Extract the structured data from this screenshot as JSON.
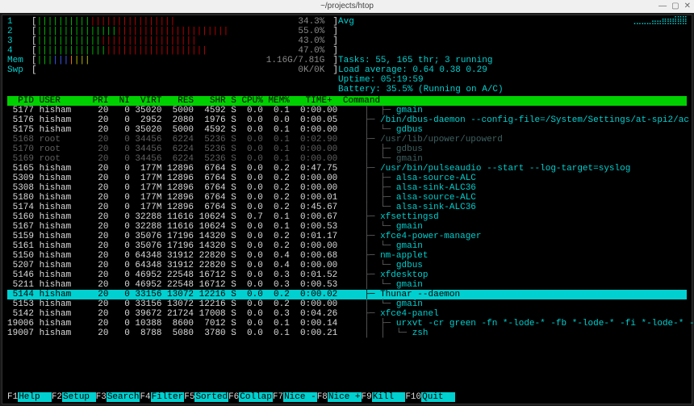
{
  "window": {
    "title": "~/projects/htop"
  },
  "meters": {
    "cpu": [
      {
        "label": "1",
        "pct": "34.3%"
      },
      {
        "label": "2",
        "pct": "55.0%"
      },
      {
        "label": "3",
        "pct": "43.0%"
      },
      {
        "label": "4",
        "pct": "47.0%"
      }
    ],
    "mem": {
      "label": "Mem",
      "value": "1.16G/7.81G"
    },
    "swp": {
      "label": "Swp",
      "value": "0K/0K"
    }
  },
  "info": {
    "avg_label": "Avg",
    "tasks": "Tasks: 55, 165 thr; 3 running",
    "loadavg": "Load average: 0.64 0.38 0.29",
    "uptime": "Uptime: 05:19:59",
    "battery": "Battery: 35.5% (Running on A/C)"
  },
  "headers": "  PID USER      PRI  NI  VIRT   RES   SHR S CPU% MEM%   TIME+  Command",
  "processes": [
    {
      "cols": " 5177 hisham     20   0 35020  5000  4592 S  0.0  0.1  0:00.00",
      "tree": "   │  ├─ ",
      "cmd": "gmain"
    },
    {
      "cols": " 5176 hisham     20   0  2952  2080  1976 S  0.0  0.0  0:00.05",
      "tree": "   ├─ ",
      "cmd": "/bin/dbus-daemon --config-file=/System/Settings/at-spi2/ac"
    },
    {
      "cols": " 5175 hisham     20   0 35020  5000  4592 S  0.0  0.1  0:00.00",
      "tree": "   │  └─ ",
      "cmd": "gdbus"
    },
    {
      "cols": " 5168 root       20   0 34456  6224  5236 S  0.0  0.1  0:02.90",
      "tree": "   ├─ ",
      "cmd": "/usr/lib/upower/upowerd",
      "dim": true
    },
    {
      "cols": " 5170 root       20   0 34456  6224  5236 S  0.0  0.1  0:00.00",
      "tree": "   │  ├─ ",
      "cmd": "gdbus",
      "dim": true
    },
    {
      "cols": " 5169 root       20   0 34456  6224  5236 S  0.0  0.1  0:00.00",
      "tree": "   │  └─ ",
      "cmd": "gmain",
      "dim": true
    },
    {
      "cols": " 5165 hisham     20   0  177M 12896  6764 S  0.0  0.2  0:47.75",
      "tree": "   ├─ ",
      "cmd": "/usr/bin/pulseaudio --start --log-target=syslog"
    },
    {
      "cols": " 5309 hisham     20   0  177M 12896  6764 S  0.0  0.2  0:00.00",
      "tree": "   │  ├─ ",
      "cmd": "alsa-source-ALC"
    },
    {
      "cols": " 5308 hisham     20   0  177M 12896  6764 S  0.0  0.2  0:00.00",
      "tree": "   │  ├─ ",
      "cmd": "alsa-sink-ALC36"
    },
    {
      "cols": " 5180 hisham     20   0  177M 12896  6764 S  0.0  0.2  0:00.01",
      "tree": "   │  ├─ ",
      "cmd": "alsa-source-ALC"
    },
    {
      "cols": " 5174 hisham     20   0  177M 12896  6764 S  0.0  0.2  0:45.67",
      "tree": "   │  └─ ",
      "cmd": "alsa-sink-ALC36"
    },
    {
      "cols": " 5160 hisham     20   0 32288 11616 10624 S  0.7  0.1  0:00.67",
      "tree": "   ├─ ",
      "cmd": "xfsettingsd"
    },
    {
      "cols": " 5167 hisham     20   0 32288 11616 10624 S  0.0  0.1  0:00.53",
      "tree": "   │  └─ ",
      "cmd": "gmain"
    },
    {
      "cols": " 5159 hisham     20   0 35076 17196 14320 S  0.0  0.2  0:01.17",
      "tree": "   ├─ ",
      "cmd": "xfce4-power-manager"
    },
    {
      "cols": " 5161 hisham     20   0 35076 17196 14320 S  0.0  0.2  0:00.00",
      "tree": "   │  └─ ",
      "cmd": "gmain"
    },
    {
      "cols": " 5150 hisham     20   0 64348 31912 22820 S  0.0  0.4  0:00.68",
      "tree": "   ├─ ",
      "cmd": "nm-applet"
    },
    {
      "cols": " 5207 hisham     20   0 64348 31912 22820 S  0.0  0.4  0:00.00",
      "tree": "   │  └─ ",
      "cmd": "gdbus"
    },
    {
      "cols": " 5146 hisham     20   0 46952 22548 16712 S  0.0  0.3  0:01.52",
      "tree": "   ├─ ",
      "cmd": "xfdesktop"
    },
    {
      "cols": " 5211 hisham     20   0 46952 22548 16712 S  0.0  0.3  0:00.53",
      "tree": "   │  └─ ",
      "cmd": "gmain"
    },
    {
      "cols": " 5144 hisham     20   0 33156 13072 12216 S  0.0  0.2  0:00.02",
      "tree": "   ├─ ",
      "cmd": "Thunar --daemon",
      "sel": true
    },
    {
      "cols": " 5153 hisham     20   0 33156 13072 12216 S  0.0  0.2  0:00.00",
      "tree": "   │  └─ ",
      "cmd": "gmain"
    },
    {
      "cols": " 5142 hisham     20   0 39672 21724 17008 S  0.0  0.3  0:04.26",
      "tree": "   ├─ ",
      "cmd": "xfce4-panel"
    },
    {
      "cols": "19006 hisham     20   0 10388  8600  7012 S  0.0  0.1  0:00.14",
      "tree": "   │  ├─ ",
      "cmd": "urxvt -cr green -fn *-lode-* -fb *-lode-* -fi *-lode-* -fb"
    },
    {
      "cols": "19007 hisham     20   0  8788  5080  3780 S  0.0  0.1  0:00.21",
      "tree": "   │  │  └─ ",
      "cmd": "zsh"
    }
  ],
  "footer": [
    {
      "key": "F1",
      "label": "Help  "
    },
    {
      "key": "F2",
      "label": "Setup "
    },
    {
      "key": "F3",
      "label": "Search"
    },
    {
      "key": "F4",
      "label": "Filter"
    },
    {
      "key": "F5",
      "label": "Sorted"
    },
    {
      "key": "F6",
      "label": "Collap"
    },
    {
      "key": "F7",
      "label": "Nice -"
    },
    {
      "key": "F8",
      "label": "Nice +"
    },
    {
      "key": "F9",
      "label": "Kill  "
    },
    {
      "key": "F10",
      "label": "Quit  "
    }
  ]
}
